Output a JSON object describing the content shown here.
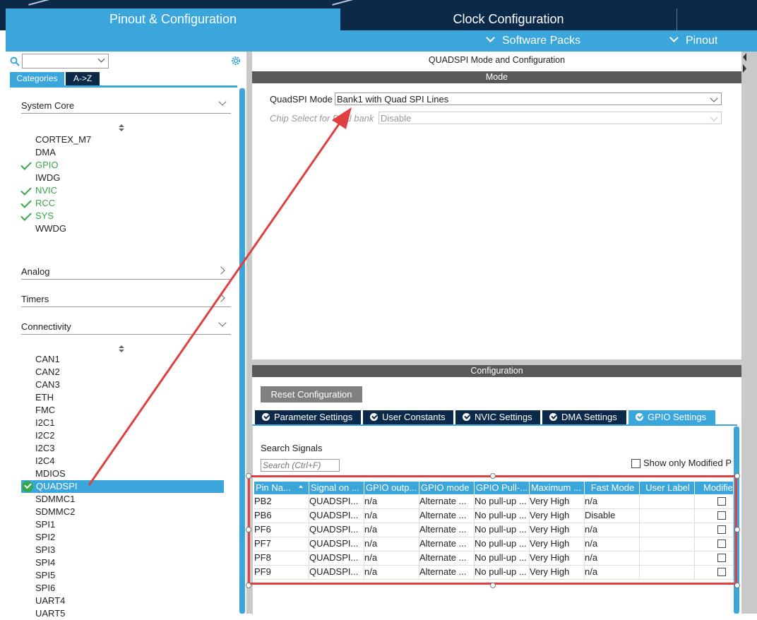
{
  "main_tabs": {
    "pinout": "Pinout & Configuration",
    "clock": "Clock Configuration"
  },
  "subbar": {
    "software_packs": "Software Packs",
    "pinout": "Pinout"
  },
  "left": {
    "search_value": "",
    "tab_categories": "Categories",
    "tab_az": "A->Z",
    "system_core": {
      "title": "System Core",
      "items": [
        "CORTEX_M7",
        "DMA",
        "GPIO",
        "IWDG",
        "NVIC",
        "RCC",
        "SYS",
        "WWDG"
      ],
      "checked": [
        false,
        false,
        true,
        false,
        true,
        true,
        true,
        false
      ]
    },
    "analog": "Analog",
    "timers": "Timers",
    "connectivity": {
      "title": "Connectivity",
      "items": [
        "CAN1",
        "CAN2",
        "CAN3",
        "ETH",
        "FMC",
        "I2C1",
        "I2C2",
        "I2C3",
        "I2C4",
        "MDIOS",
        "QUADSPI",
        "SDMMC1",
        "SDMMC2",
        "SPI1",
        "SPI2",
        "SPI3",
        "SPI4",
        "SPI5",
        "SPI6",
        "UART4",
        "UART5"
      ],
      "selected": "QUADSPI"
    }
  },
  "right": {
    "title": "QUADSPI Mode and Configuration",
    "mode_bar": "Mode",
    "quadspi_mode_label": "QuadSPI Mode",
    "quadspi_mode_value": "Bank1 with Quad SPI Lines",
    "chip_select_label": "Chip Select for Dual bank",
    "chip_select_value": "Disable",
    "config_bar": "Configuration",
    "reset_button": "Reset Configuration",
    "tabs": [
      "Parameter Settings",
      "User Constants",
      "NVIC Settings",
      "DMA Settings",
      "GPIO Settings"
    ],
    "active_tab": "GPIO Settings",
    "search_signals_label": "Search Signals",
    "search_placeholder": "Search (Ctrl+F)",
    "show_modified_label": "Show only Modified Pins",
    "table": {
      "headers": [
        "Pin Na...",
        "Signal on ...",
        "GPIO outp...",
        "GPIO mode",
        "GPIO Pull-...",
        "Maximum ...",
        "Fast Mode",
        "User Label",
        "Modified"
      ],
      "rows": [
        [
          "PB2",
          "QUADSPI...",
          "n/a",
          "Alternate ...",
          "No pull-up ...",
          "Very High",
          "n/a",
          "",
          false
        ],
        [
          "PB6",
          "QUADSPI...",
          "n/a",
          "Alternate ...",
          "No pull-up ...",
          "Very High",
          "Disable",
          "",
          false
        ],
        [
          "PF6",
          "QUADSPI...",
          "n/a",
          "Alternate ...",
          "No pull-up ...",
          "Very High",
          "n/a",
          "",
          false
        ],
        [
          "PF7",
          "QUADSPI...",
          "n/a",
          "Alternate ...",
          "No pull-up ...",
          "Very High",
          "n/a",
          "",
          false
        ],
        [
          "PF8",
          "QUADSPI...",
          "n/a",
          "Alternate ...",
          "No pull-up ...",
          "Very High",
          "n/a",
          "",
          false
        ],
        [
          "PF9",
          "QUADSPI...",
          "n/a",
          "Alternate ...",
          "No pull-up ...",
          "Very High",
          "n/a",
          "",
          false
        ]
      ]
    }
  },
  "annotation_color": "#e0403f",
  "accent": "#3aa6dc",
  "dark": "#0b2a4a"
}
